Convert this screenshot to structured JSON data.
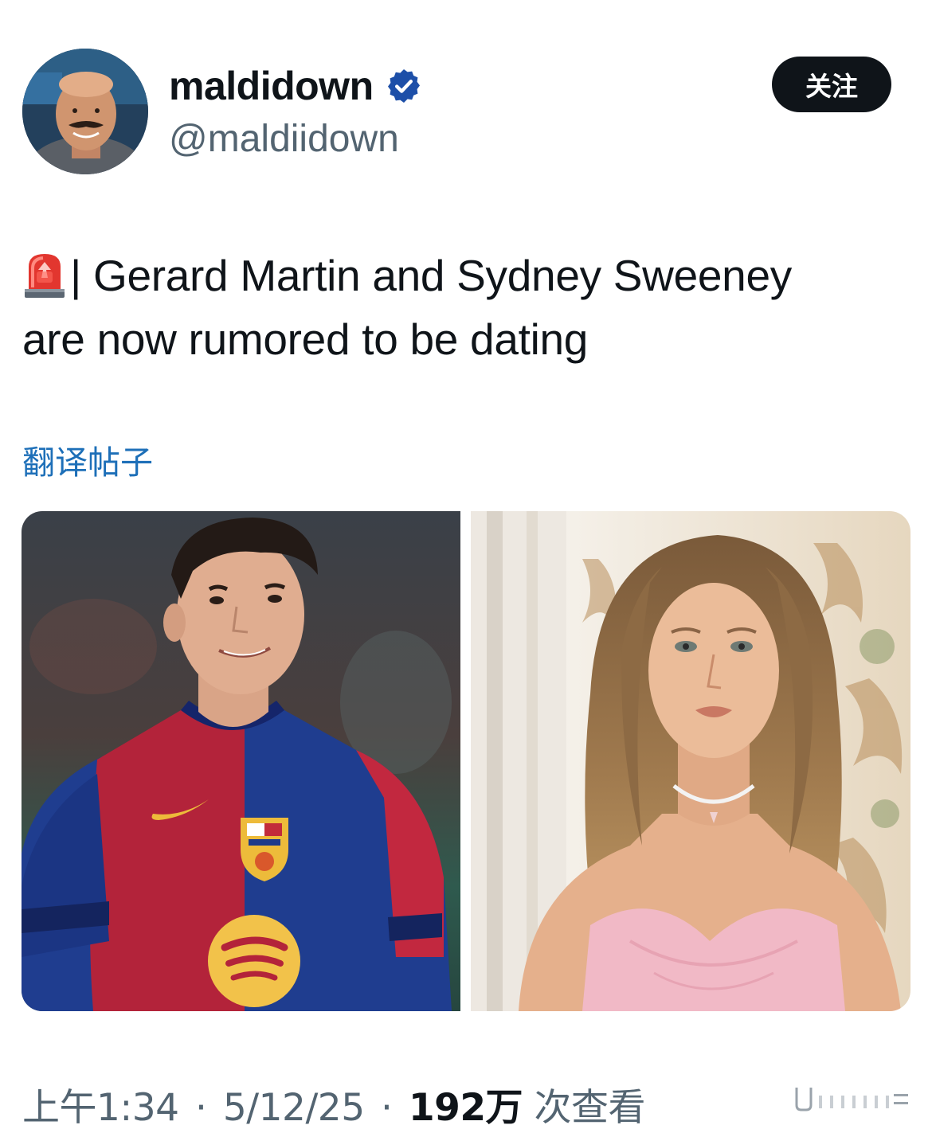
{
  "author": {
    "display_name": "maldidown",
    "handle": "@maldiidown",
    "verified_icon": "verified-badge-icon",
    "avatar": "avatar"
  },
  "follow_button": {
    "label": "关注"
  },
  "tweet": {
    "emoji": "siren-icon",
    "text_line1": "| Gerard Martin and Sydney Sweeney",
    "text_line2": "are now rumored to be dating",
    "translate_label": "翻译帖子"
  },
  "media": {
    "photos": [
      "photo-left",
      "photo-right"
    ]
  },
  "meta": {
    "time": "上午1:34",
    "date": "5/12/25",
    "views_count": "192万",
    "views_label": "次查看",
    "separator": "·"
  },
  "colors": {
    "follow_bg": "#0f1419",
    "link": "#1d6fb8",
    "secondary_text": "#536471",
    "verified": "#1d6fd6"
  }
}
